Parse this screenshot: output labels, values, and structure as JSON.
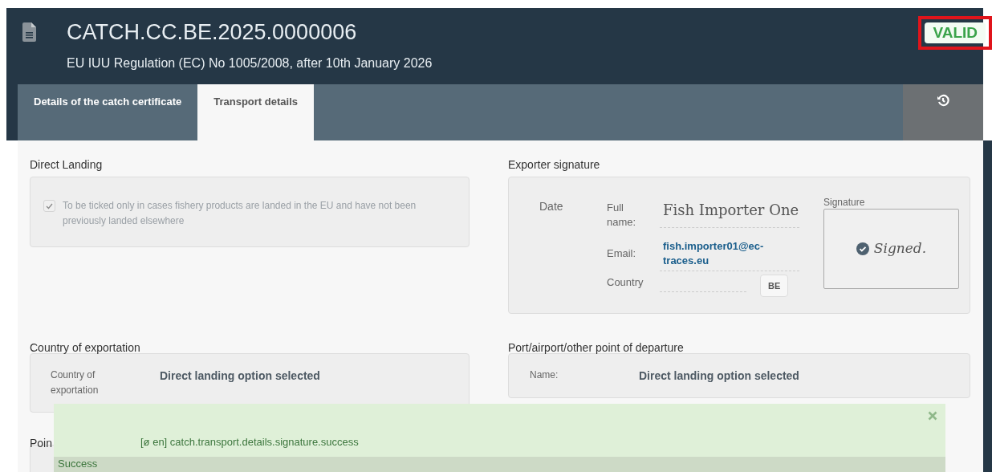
{
  "document": {
    "title": "CATCH.CC.BE.2025.0000006",
    "subtitle": "EU IUU Regulation (EC) No 1005/2008, after 10th January 2026",
    "status": "VALID",
    "highlighted": true
  },
  "tabs": [
    {
      "label": "Details of the catch certificate",
      "selected": false
    },
    {
      "label": "Transport details",
      "selected": true
    }
  ],
  "direct_landing": {
    "heading": "Direct Landing",
    "checked": true,
    "label": "To be ticked only in cases fishery products are landed in the EU and have not been previously landed elsewhere"
  },
  "exporter_signature": {
    "heading": "Exporter signature",
    "date_label": "Date",
    "fields": [
      {
        "kind": "name",
        "label": "Full name:",
        "value": "Fish Importer One"
      },
      {
        "kind": "email",
        "label": "Email:",
        "value": "fish.importer01@ec-traces.eu"
      },
      {
        "kind": "country",
        "label": "Country",
        "value": "BE"
      }
    ],
    "signature_label": "Signature",
    "signed": true,
    "signature_text": "Signed."
  },
  "country_of_exportation": {
    "heading": "Country of exportation",
    "label": "Country of exportation",
    "value": "Direct landing option selected"
  },
  "departure": {
    "heading": "Port/airport/other point of departure",
    "label": "Name:",
    "value": "Direct landing option selected"
  },
  "next_section": {
    "heading": "Poin"
  },
  "toast": {
    "message": "[ø en] catch.transport.details.signature.success",
    "title": "Success"
  }
}
